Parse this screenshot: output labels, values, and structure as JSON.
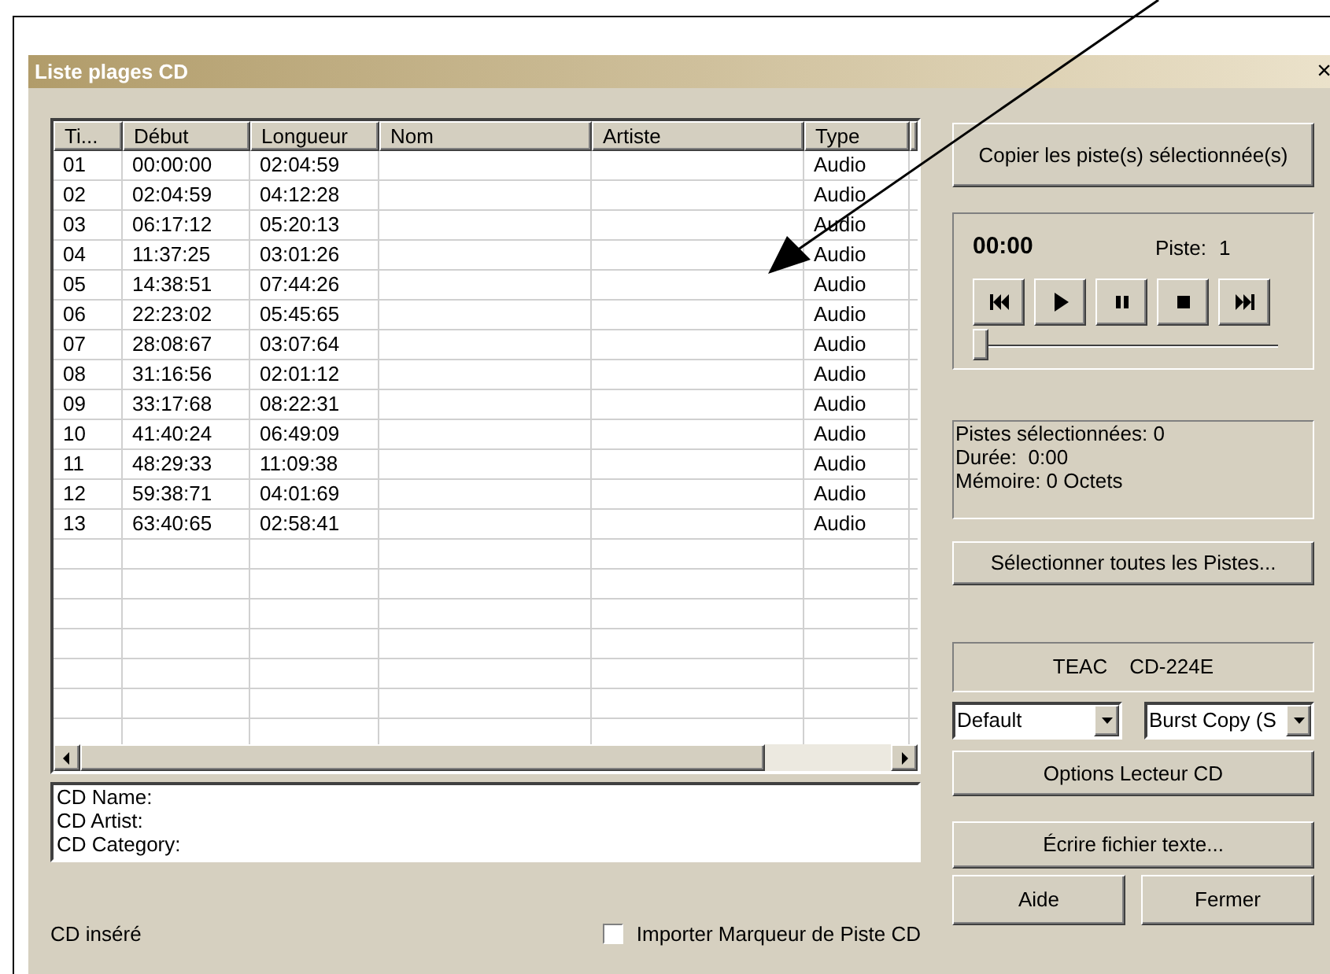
{
  "window": {
    "title": "Liste plages CD",
    "close": "×"
  },
  "table": {
    "columns": [
      "Ti...",
      "Début",
      "Longueur",
      "Nom",
      "Artiste",
      "Type"
    ],
    "rows": [
      {
        "track": "01",
        "start": "00:00:00",
        "length": "02:04:59",
        "type": "Audio"
      },
      {
        "track": "02",
        "start": "02:04:59",
        "length": "04:12:28",
        "type": "Audio"
      },
      {
        "track": "03",
        "start": "06:17:12",
        "length": "05:20:13",
        "type": "Audio"
      },
      {
        "track": "04",
        "start": "11:37:25",
        "length": "03:01:26",
        "type": "Audio"
      },
      {
        "track": "05",
        "start": "14:38:51",
        "length": "07:44:26",
        "type": "Audio"
      },
      {
        "track": "06",
        "start": "22:23:02",
        "length": "05:45:65",
        "type": "Audio"
      },
      {
        "track": "07",
        "start": "28:08:67",
        "length": "03:07:64",
        "type": "Audio"
      },
      {
        "track": "08",
        "start": "31:16:56",
        "length": "02:01:12",
        "type": "Audio"
      },
      {
        "track": "09",
        "start": "33:17:68",
        "length": "08:22:31",
        "type": "Audio"
      },
      {
        "track": "10",
        "start": "41:40:24",
        "length": "06:49:09",
        "type": "Audio"
      },
      {
        "track": "11",
        "start": "48:29:33",
        "length": "11:09:38",
        "type": "Audio"
      },
      {
        "track": "12",
        "start": "59:38:71",
        "length": "04:01:69",
        "type": "Audio"
      },
      {
        "track": "13",
        "start": "63:40:65",
        "length": "02:58:41",
        "type": "Audio"
      }
    ]
  },
  "cd_info": [
    "CD Name:",
    "CD Artist:",
    "CD Category:"
  ],
  "status": "CD inséré",
  "import_checkbox": {
    "label": "Importer Marqueur de Piste CD",
    "checked": false
  },
  "copy_button": "Copier les piste(s) sélectionnée(s)",
  "player": {
    "time": "00:00",
    "track_label": "Piste:",
    "track_number": "1",
    "buttons": [
      {
        "kind": "previous"
      },
      {
        "kind": "play"
      },
      {
        "kind": "pause"
      },
      {
        "kind": "stop"
      },
      {
        "kind": "next"
      }
    ],
    "slider": {
      "level": 0
    }
  },
  "selection_info": [
    "Pistes sélectionnées: 0",
    "Durée:  0:00",
    "Mémoire: 0 Octets"
  ],
  "select_all_button": "Sélectionner toutes les Pistes...",
  "drive": {
    "vendor": "TEAC",
    "model": "CD-224E"
  },
  "dropdowns": [
    {
      "value": "Default"
    },
    {
      "value": "Burst Copy (S"
    }
  ],
  "options_button": "Options Lecteur CD",
  "write_button": "Écrire fichier texte...",
  "help_button": "Aide",
  "close_button": "Fermer"
}
